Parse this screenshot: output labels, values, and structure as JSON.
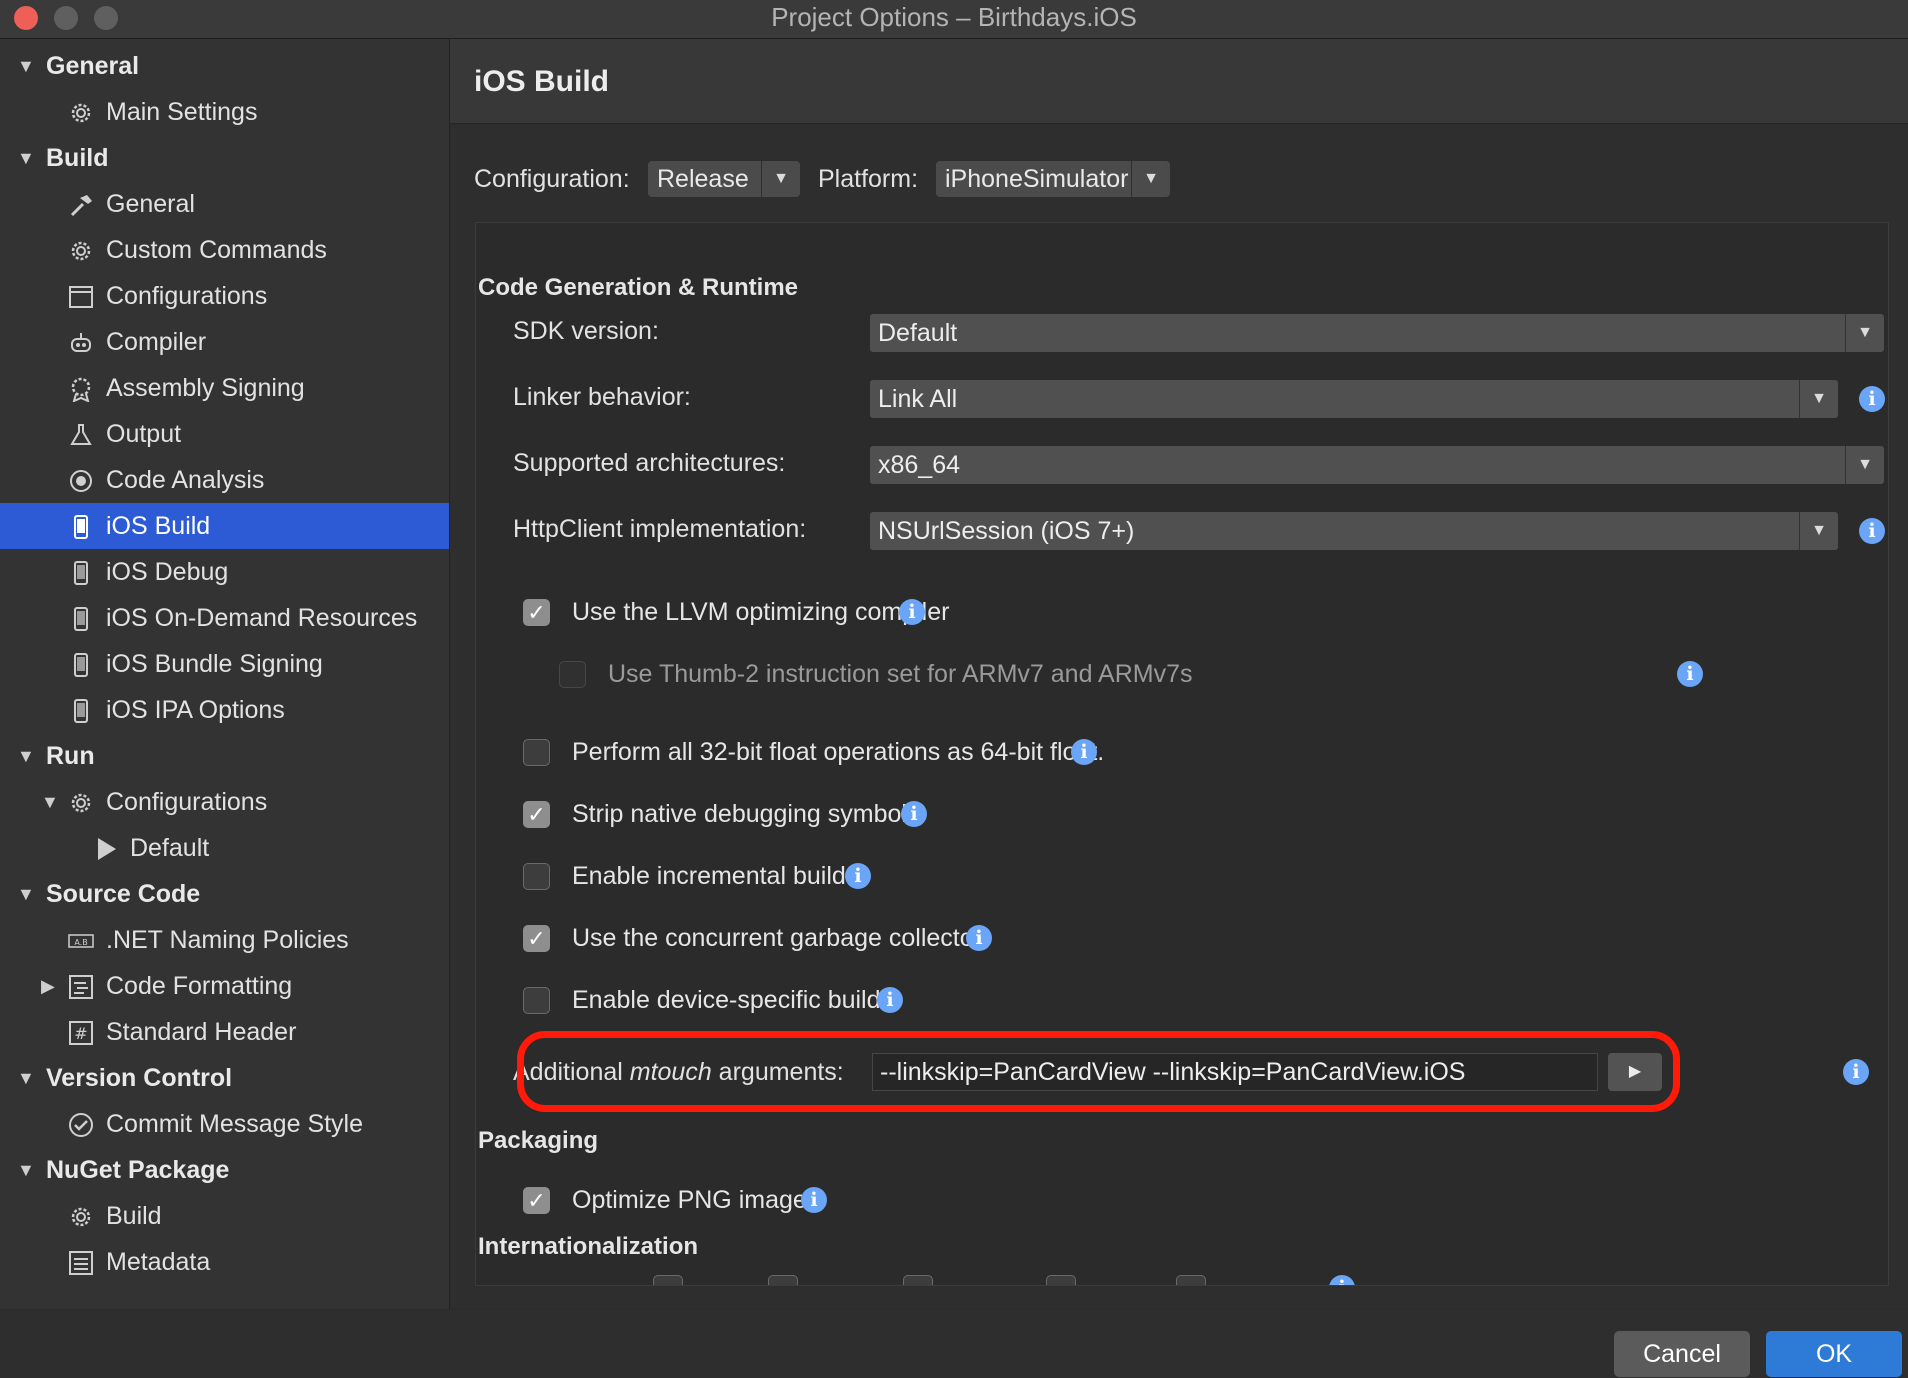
{
  "window": {
    "title": "Project Options – Birthdays.iOS"
  },
  "sidebar": {
    "items": [
      {
        "label": "General",
        "kind": "group",
        "icon": "chevron-down-icon"
      },
      {
        "label": "Main Settings",
        "kind": "item",
        "icon": "gear-icon"
      },
      {
        "label": "Build",
        "kind": "group",
        "icon": "chevron-down-icon"
      },
      {
        "label": "General",
        "kind": "item",
        "icon": "hammer-icon"
      },
      {
        "label": "Custom Commands",
        "kind": "item",
        "icon": "gear-icon"
      },
      {
        "label": "Configurations",
        "kind": "item",
        "icon": "window-icon"
      },
      {
        "label": "Compiler",
        "kind": "item",
        "icon": "robot-icon"
      },
      {
        "label": "Assembly Signing",
        "kind": "item",
        "icon": "seal-icon"
      },
      {
        "label": "Output",
        "kind": "item",
        "icon": "flask-icon"
      },
      {
        "label": "Code Analysis",
        "kind": "item",
        "icon": "target-icon"
      },
      {
        "label": "iOS Build",
        "kind": "item",
        "icon": "phone-icon",
        "selected": true
      },
      {
        "label": "iOS Debug",
        "kind": "item",
        "icon": "phone-icon"
      },
      {
        "label": "iOS On-Demand Resources",
        "kind": "item",
        "icon": "phone-icon"
      },
      {
        "label": "iOS Bundle Signing",
        "kind": "item",
        "icon": "phone-icon"
      },
      {
        "label": "iOS IPA Options",
        "kind": "item",
        "icon": "phone-icon"
      },
      {
        "label": "Run",
        "kind": "group",
        "icon": "chevron-down-icon"
      },
      {
        "label": "Configurations",
        "kind": "item",
        "icon": "gear-icon"
      },
      {
        "label": "Default",
        "kind": "subitem",
        "icon": "play-icon"
      },
      {
        "label": "Source Code",
        "kind": "group",
        "icon": "chevron-down-icon"
      },
      {
        "label": ".NET Naming Policies",
        "kind": "item",
        "icon": "naming-icon"
      },
      {
        "label": "Code Formatting",
        "kind": "item",
        "icon": "format-icon"
      },
      {
        "label": "Standard Header",
        "kind": "item",
        "icon": "hash-icon"
      },
      {
        "label": "Version Control",
        "kind": "group",
        "icon": "chevron-down-icon"
      },
      {
        "label": "Commit Message Style",
        "kind": "item",
        "icon": "check-circle-icon"
      },
      {
        "label": "NuGet Package",
        "kind": "group",
        "icon": "chevron-down-icon"
      },
      {
        "label": "Build",
        "kind": "item",
        "icon": "gear-icon"
      },
      {
        "label": "Metadata",
        "kind": "item",
        "icon": "list-icon"
      }
    ]
  },
  "main": {
    "title": "iOS Build",
    "configuration_label": "Configuration:",
    "configuration_value": "Release",
    "platform_label": "Platform:",
    "platform_value": "iPhoneSimulator",
    "sections": {
      "codegen": "Code Generation & Runtime",
      "packaging": "Packaging",
      "i18n": "Internationalization"
    },
    "fields": {
      "sdk_label": "SDK version:",
      "sdk_value": "Default",
      "linker_label": "Linker behavior:",
      "linker_value": "Link All",
      "arch_label": "Supported architectures:",
      "arch_value": "x86_64",
      "http_label": "HttpClient implementation:",
      "http_value": "NSUrlSession (iOS 7+)"
    },
    "options": {
      "llvm": "Use the LLVM optimizing compiler",
      "thumb2": "Use Thumb-2 instruction set for ARMv7 and ARMv7s",
      "float64": "Perform all 32-bit float operations as 64-bit float.",
      "strip": "Strip native debugging symbols",
      "incremental": "Enable incremental builds",
      "concurrent_gc": "Use the concurrent garbage collector",
      "device_specific": "Enable device-specific builds",
      "optimize_png": "Optimize PNG images"
    },
    "mtouch": {
      "label_prefix": "Additional ",
      "label_em": "mtouch",
      "label_suffix": " arguments:",
      "value": "--linkskip=PanCardView --linkskip=PanCardView.iOS"
    }
  },
  "footer": {
    "cancel": "Cancel",
    "ok": "OK"
  },
  "colors": {
    "selection": "#2d5bd6",
    "ok_button": "#2d7bd6",
    "info_icon": "#6aa5f7",
    "highlight_ring": "#ff1a0a"
  }
}
